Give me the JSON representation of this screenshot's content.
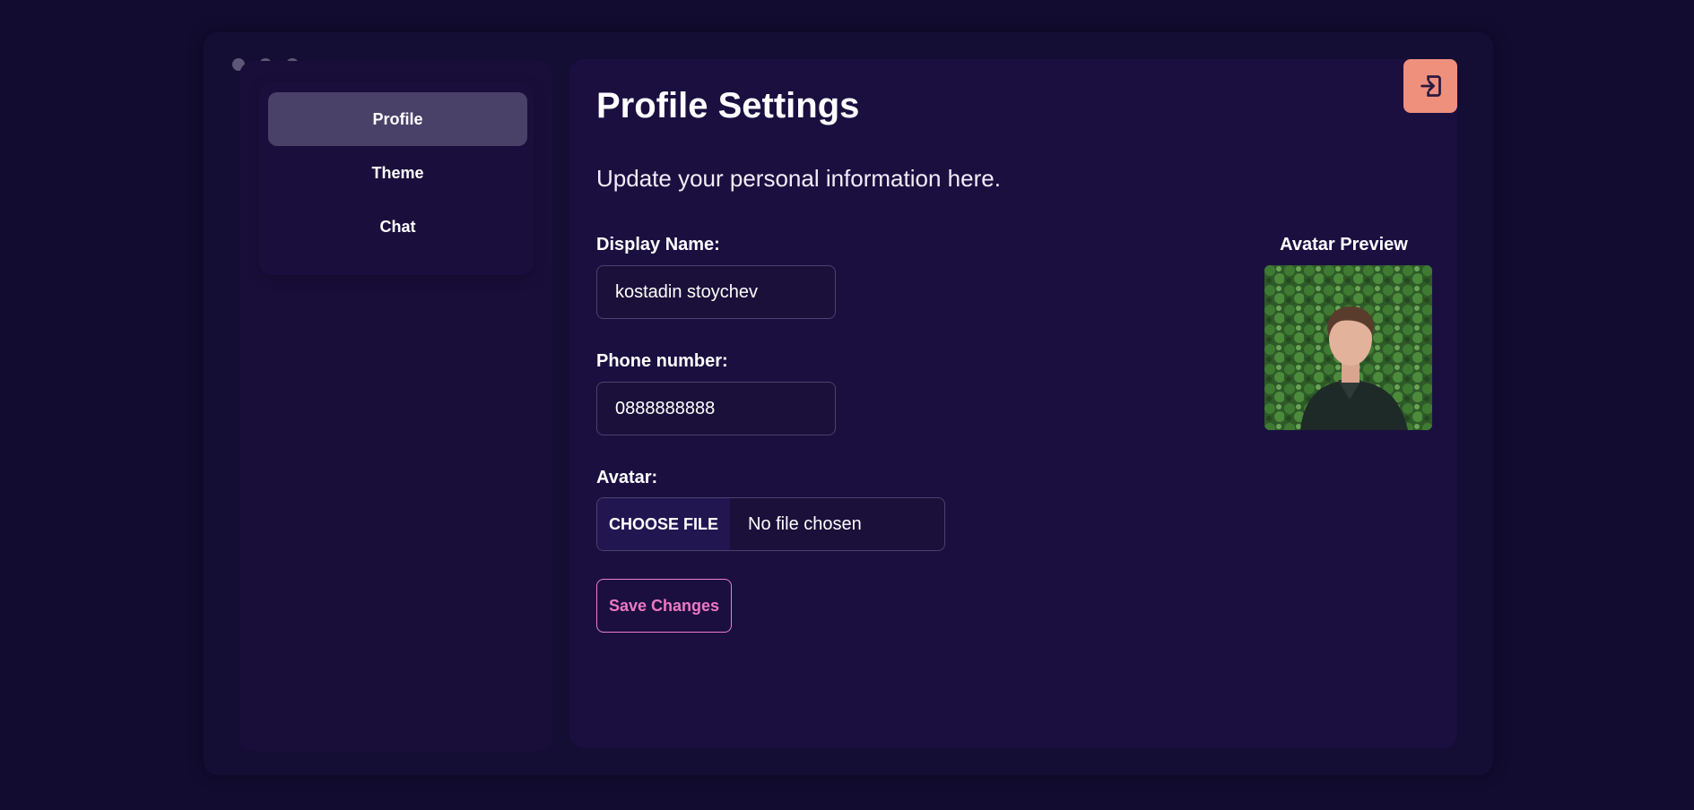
{
  "window": {
    "controls": [
      "close",
      "minimize",
      "maximize"
    ]
  },
  "sidebar": {
    "items": [
      {
        "label": "Profile",
        "active": true
      },
      {
        "label": "Theme",
        "active": false
      },
      {
        "label": "Chat",
        "active": false
      }
    ]
  },
  "main": {
    "title": "Profile Settings",
    "subtitle": "Update your personal information here.",
    "logout_icon": "logout-icon",
    "form": {
      "display_name": {
        "label": "Display Name:",
        "value": "kostadin stoychev"
      },
      "phone": {
        "label": "Phone number:",
        "value": "0888888888"
      },
      "avatar": {
        "label": "Avatar:",
        "button_label": "CHOOSE FILE",
        "status": "No file chosen"
      },
      "save_label": "Save Changes"
    },
    "avatar_preview": {
      "label": "Avatar Preview"
    }
  },
  "colors": {
    "background": "#120c30",
    "panel": "#1b0f40",
    "active_item": "#4a4168",
    "logout_button": "#ef907d",
    "save_accent": "#ef78c4"
  }
}
